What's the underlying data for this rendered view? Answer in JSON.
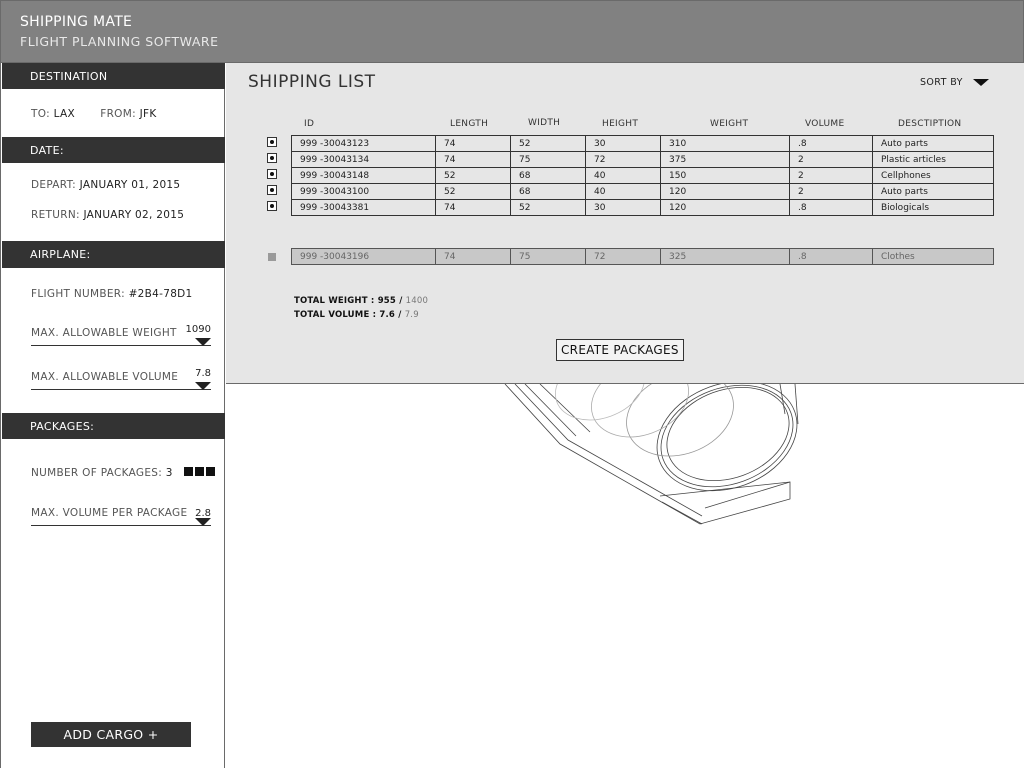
{
  "header": {
    "title": "SHIPPING MATE",
    "subtitle": "FLIGHT PLANNING SOFTWARE"
  },
  "sidebar": {
    "destination": {
      "heading": "DESTINATION",
      "to_label": "TO:",
      "to_value": "LAX",
      "from_label": "FROM:",
      "from_value": "JFK"
    },
    "date": {
      "heading": "DATE:",
      "depart_label": "DEPART:",
      "depart_value": "JANUARY 01, 2015",
      "return_label": "RETURN:",
      "return_value": "JANUARY 02, 2015"
    },
    "airplane": {
      "heading": "AIRPLANE:",
      "flight_label": "FLIGHT NUMBER:",
      "flight_value": "#2B4-78D1",
      "max_weight_label": "MAX. ALLOWABLE WEIGHT",
      "max_weight_value": "1090",
      "max_volume_label": "MAX. ALLOWABLE VOLUME",
      "max_volume_value": "7.8"
    },
    "packages": {
      "heading": "PACKAGES:",
      "count_label": "NUMBER OF PACKAGES:",
      "count_value": "3",
      "count_squares": 3,
      "max_volume_label": "MAX. VOLUME PER PACKAGE",
      "max_volume_value": "2.8"
    },
    "add_cargo_label": "ADD CARGO +"
  },
  "shipping_list": {
    "title": "SHIPPING LIST",
    "sort_label": "SORT BY",
    "columns": [
      "ID",
      "LENGTH",
      "WIDTH",
      "HEIGHT",
      "WEIGHT",
      "VOLUME",
      "DESCTIPTION"
    ],
    "rows": [
      [
        "999 -30043123",
        "74",
        "52",
        "30",
        "310",
        ".8",
        "Auto parts"
      ],
      [
        "999 -30043134",
        "74",
        "75",
        "72",
        "375",
        "2",
        "Plastic articles"
      ],
      [
        "999 -30043148",
        "52",
        "68",
        "40",
        "150",
        "2",
        "Cellphones"
      ],
      [
        "999 -30043100",
        "52",
        "68",
        "40",
        "120",
        "2",
        "Auto parts"
      ],
      [
        "999 -30043381",
        "74",
        "52",
        "30",
        "120",
        ".8",
        "Biologicals"
      ]
    ],
    "pending_row": [
      "999 -30043196",
      "74",
      "75",
      "72",
      "325",
      ".8",
      "Clothes"
    ],
    "total_weight_label": "TOTAL WEIGHT :",
    "total_weight_value": "955",
    "total_weight_max": "1400",
    "total_volume_label": "TOTAL VOLUME :",
    "total_volume_value": "7.6",
    "total_volume_max": "7.9",
    "create_label": "CREATE PACKAGES"
  }
}
